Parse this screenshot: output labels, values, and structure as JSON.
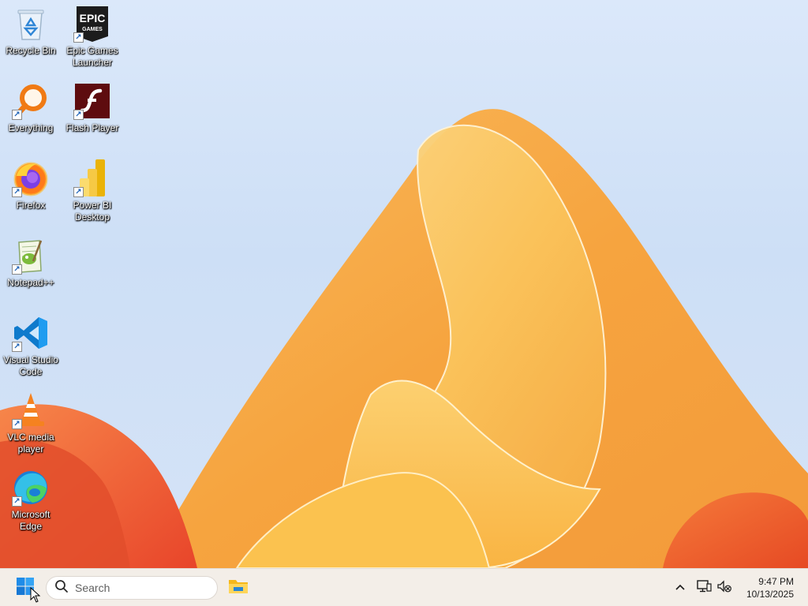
{
  "desktop": {
    "icons": [
      {
        "label": "Recycle Bin",
        "icon": "recycle-bin-icon",
        "shortcut": false
      },
      {
        "label": "Epic Games Launcher",
        "icon": "epic-games-icon",
        "shortcut": true,
        "logo_text_top": "EPIC",
        "logo_text_bottom": "GAMES"
      },
      {
        "label": "Everything",
        "icon": "everything-search-icon",
        "shortcut": true
      },
      {
        "label": "Flash Player",
        "icon": "flash-player-icon",
        "shortcut": true
      },
      {
        "label": "Firefox",
        "icon": "firefox-icon",
        "shortcut": true
      },
      {
        "label": "Power BI Desktop",
        "icon": "power-bi-icon",
        "shortcut": true
      },
      {
        "label": "Notepad++",
        "icon": "notepad-plus-plus-icon",
        "shortcut": true
      },
      {
        "label": "Visual Studio Code",
        "icon": "vscode-icon",
        "shortcut": true
      },
      {
        "label": "VLC media player",
        "icon": "vlc-icon",
        "shortcut": true
      },
      {
        "label": "Microsoft Edge",
        "icon": "edge-icon",
        "shortcut": true
      }
    ]
  },
  "taskbar": {
    "start_icon": "windows-logo-icon",
    "search": {
      "placeholder": "Search",
      "icon": "search-icon"
    },
    "pinned_apps": [
      {
        "name": "File Explorer",
        "icon": "file-explorer-icon"
      }
    ],
    "tray": {
      "chevron_icon": "chevron-up-icon",
      "network_icon": "network-icon",
      "volume_icon": "volume-muted-icon"
    },
    "clock": {
      "time": "9:47 PM",
      "date": "10/13/2025"
    }
  },
  "colors": {
    "sky": "#cfdff5",
    "wallpaper_orange": "#f7a23c",
    "wallpaper_yellow": "#fcc85a",
    "wallpaper_red": "#f05a28",
    "taskbar_bg": "#f3eee8"
  }
}
